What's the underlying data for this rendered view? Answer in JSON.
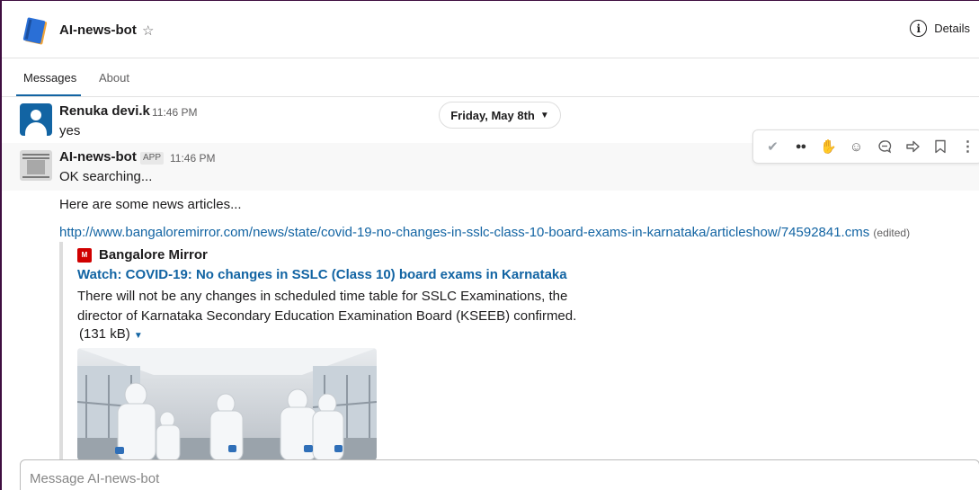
{
  "header": {
    "title": "AI-news-bot",
    "details_label": "Details",
    "icons": {
      "app": "notebook-icon",
      "star": "star-outline-icon",
      "details": "info-circle-icon"
    }
  },
  "tabs": [
    {
      "label": "Messages",
      "active": true
    },
    {
      "label": "About",
      "active": false
    }
  ],
  "date_divider": "Friday, May 8th",
  "messages": [
    {
      "sender": "Renuka devi.k",
      "time": "11:46 PM",
      "text": "yes"
    },
    {
      "sender": "AI-news-bot",
      "badge": "APP",
      "time": "11:46 PM",
      "text": "OK searching..."
    }
  ],
  "bot_followup": {
    "intro": "Here are some news articles...",
    "link": "http://www.bangaloremirror.com/news/state/covid-19-no-changes-in-sslc-class-10-board-exams-in-karnataka/articleshow/74592841.cms",
    "edited": "(edited)"
  },
  "attachment": {
    "source_icon_text": "M",
    "source": "Bangalore Mirror",
    "title": "Watch: COVID-19: No changes in SSLC (Class 10) board exams in Karnataka",
    "description": "There will not be any changes in scheduled time table for SSLC Examinations, the director of Karnataka Secondary Education Examination Board (KSEEB) confirmed.",
    "size": "(131 kB)"
  },
  "message_toolbar": [
    "checkmark-icon",
    "eyes-icon",
    "raised-hands-icon",
    "add-reaction-icon",
    "reply-thread-icon",
    "share-forward-icon",
    "bookmark-icon",
    "more-vertical-icon"
  ],
  "composer": {
    "placeholder": "Message AI-news-bot"
  },
  "colors": {
    "link": "#1264a3",
    "hover_bg": "#f8f8f8",
    "frame": "#3f0e40",
    "source_icon": "#d00000"
  }
}
